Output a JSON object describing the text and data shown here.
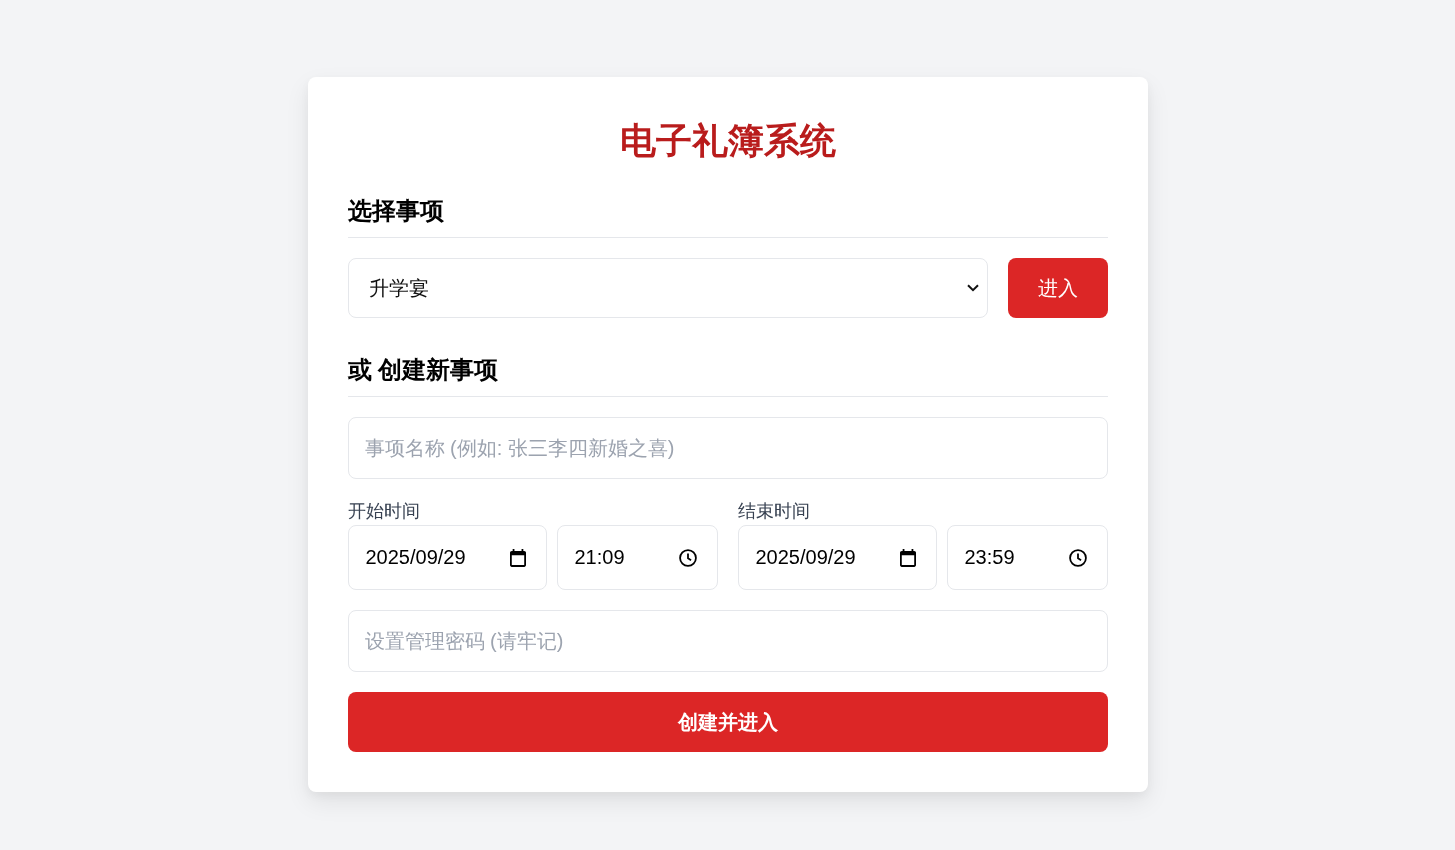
{
  "title": "电子礼簿系统",
  "select_section": {
    "heading": "选择事项",
    "event_select": {
      "value": "升学宴"
    },
    "enter_button": "进入"
  },
  "create_section": {
    "heading": "或 创建新事项",
    "name_field": {
      "placeholder": "事项名称 (例如: 张三李四新婚之喜)"
    },
    "times": [
      {
        "label": "开始时间",
        "date": "2025/09/29",
        "time": "21:09"
      },
      {
        "label": "结束时间",
        "date": "2025/09/29",
        "time": "23:59"
      }
    ],
    "password_field": {
      "placeholder": "设置管理密码 (请牢记)"
    },
    "submit_button": "创建并进入"
  }
}
